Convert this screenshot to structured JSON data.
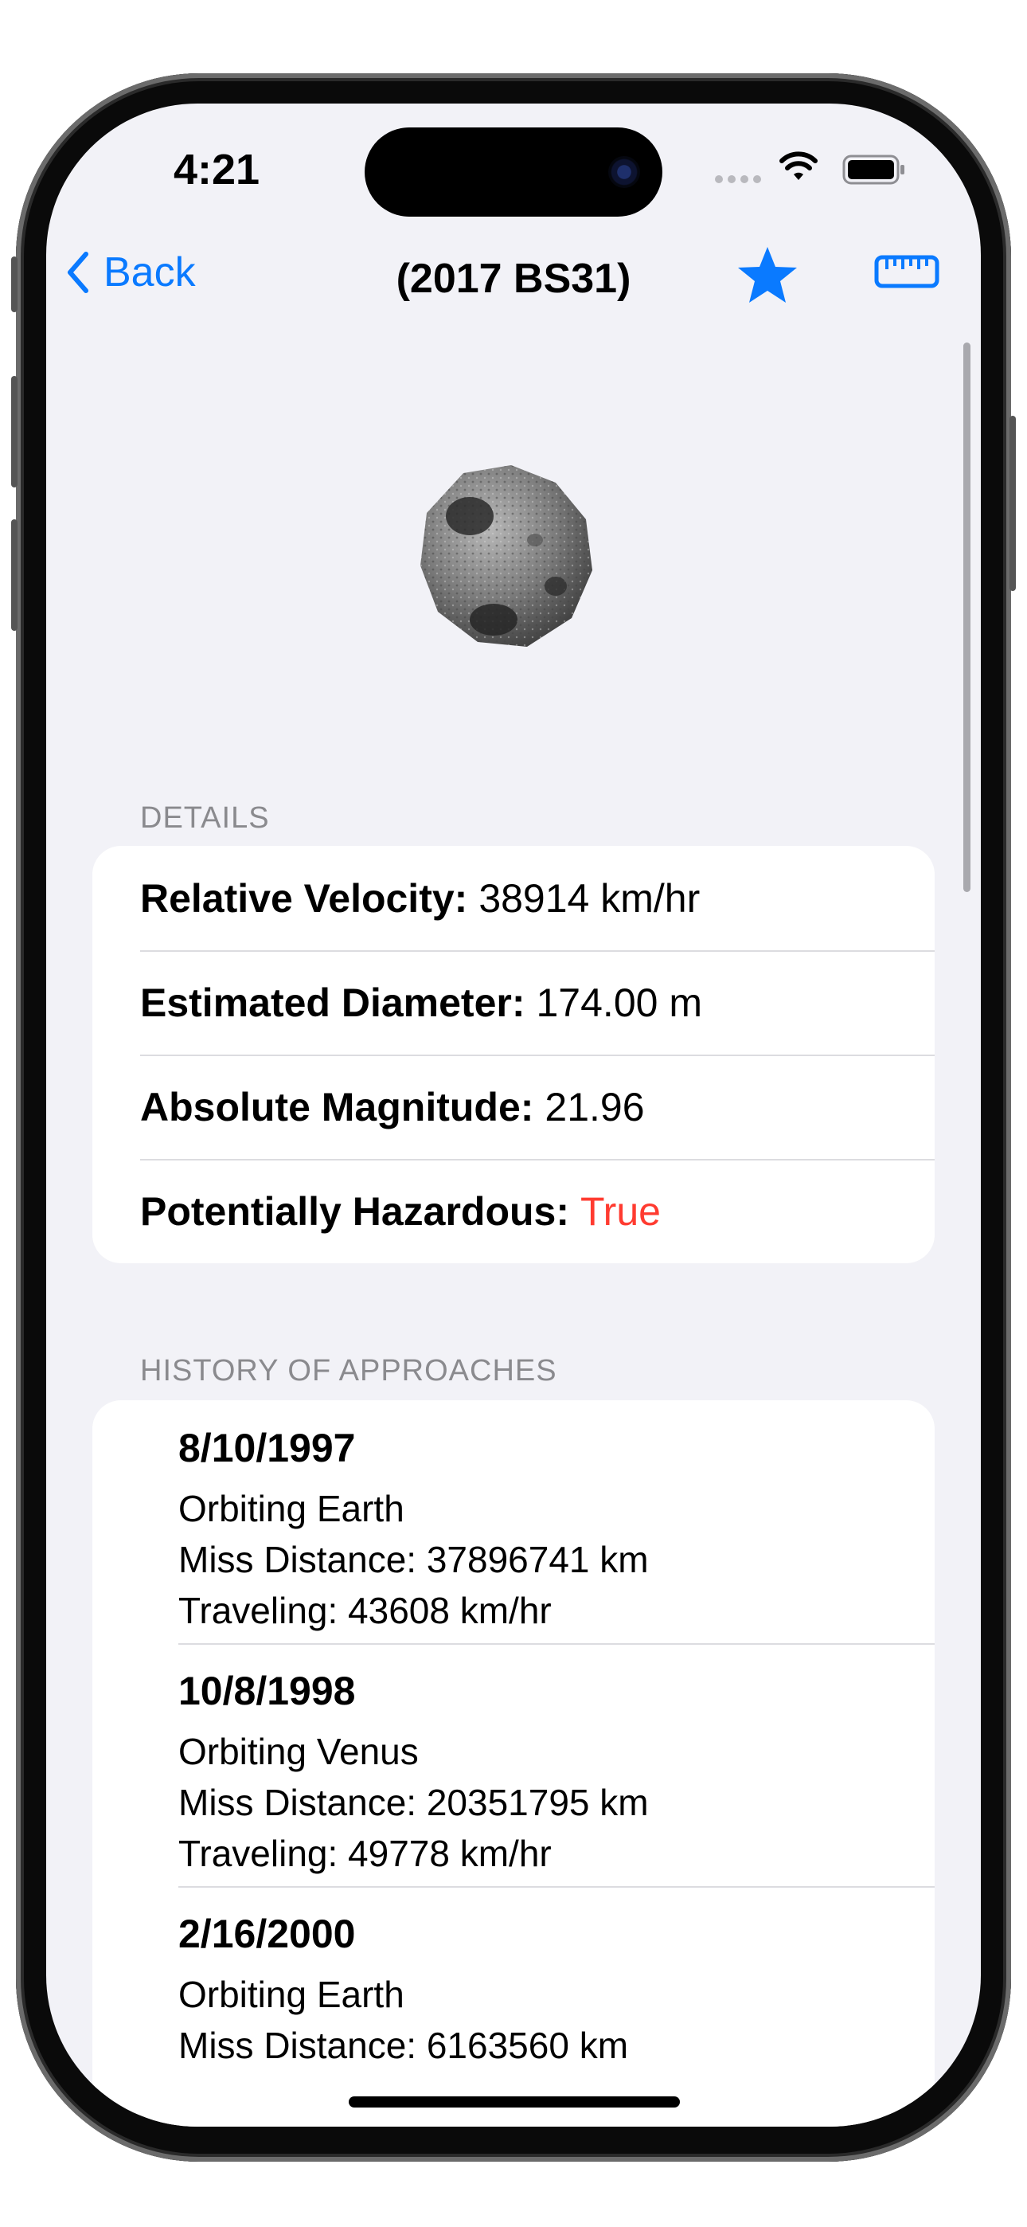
{
  "status_bar": {
    "time": "4:21"
  },
  "nav": {
    "back_label": "Back",
    "title": "(2017 BS31)",
    "favorite_icon": "star-icon",
    "measure_icon": "ruler-icon"
  },
  "details": {
    "header": "DETAILS",
    "rows": [
      {
        "label": "Relative Velocity:",
        "value": "38914 km/hr"
      },
      {
        "label": "Estimated Diameter:",
        "value": "174.00 m"
      },
      {
        "label": "Absolute Magnitude:",
        "value": "21.96"
      },
      {
        "label": "Potentially Hazardous:",
        "value": "True"
      }
    ]
  },
  "approaches": {
    "header": "HISTORY OF APPROACHES",
    "items": [
      {
        "date": "8/10/1997",
        "orbiting": "Orbiting Earth",
        "miss": "Miss Distance: 37896741 km",
        "traveling": "Traveling: 43608 km/hr"
      },
      {
        "date": "10/8/1998",
        "orbiting": "Orbiting Venus",
        "miss": "Miss Distance: 20351795 km",
        "traveling": "Traveling: 49778 km/hr"
      },
      {
        "date": "2/16/2000",
        "orbiting": "Orbiting Earth",
        "miss": "Miss Distance: 6163560 km",
        "traveling": ""
      }
    ]
  },
  "colors": {
    "accent": "#0a7aff",
    "hazard": "#ff3b30",
    "background": "#f2f2f7"
  }
}
